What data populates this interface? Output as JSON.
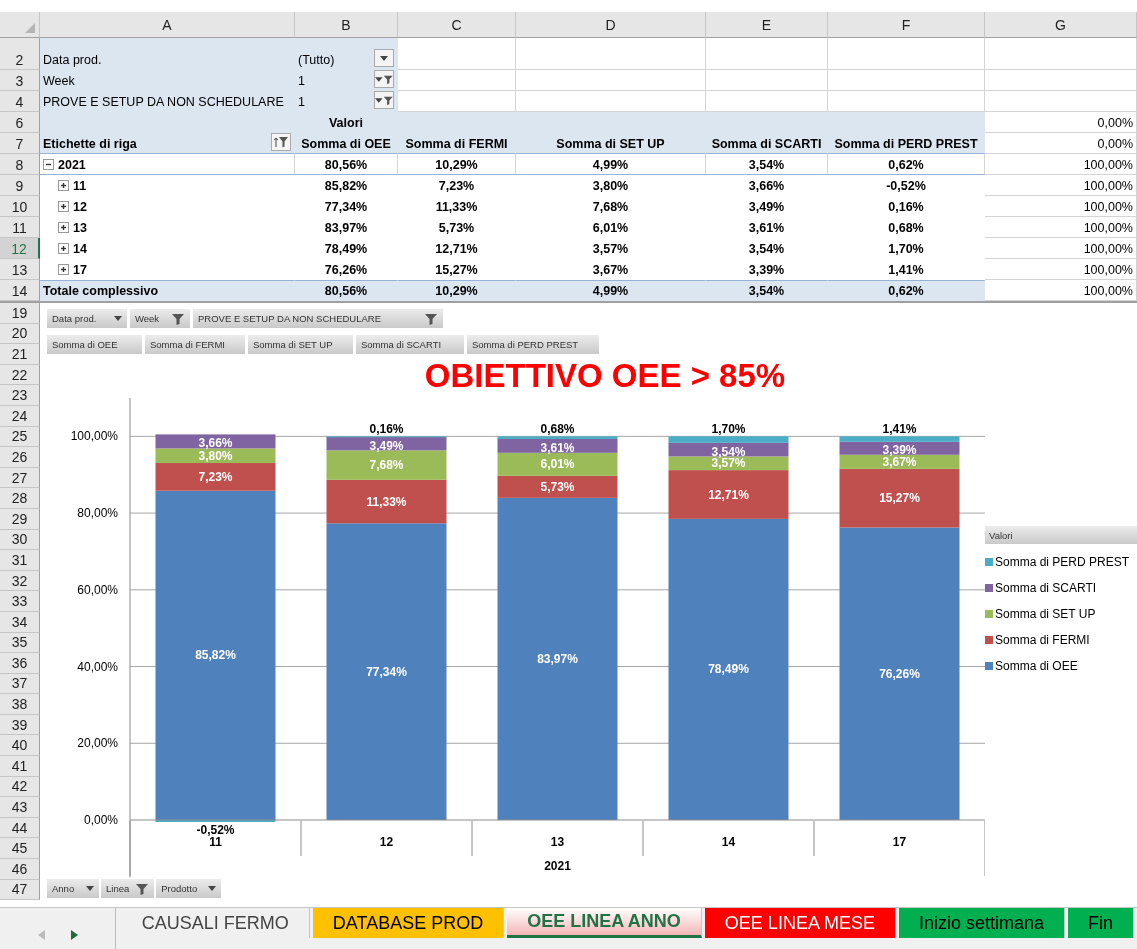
{
  "columns": [
    "A",
    "B",
    "C",
    "D",
    "E",
    "F",
    "G"
  ],
  "top_row_numbers": [
    {
      "label": "2",
      "selected": false
    },
    {
      "label": "3",
      "selected": false
    },
    {
      "label": "4",
      "selected": false
    },
    {
      "label": "6",
      "selected": false
    },
    {
      "label": "7",
      "selected": false
    },
    {
      "label": "8",
      "selected": false
    },
    {
      "label": "9",
      "selected": false
    },
    {
      "label": "10",
      "selected": false
    },
    {
      "label": "11",
      "selected": false
    },
    {
      "label": "12",
      "selected": true
    },
    {
      "label": "13",
      "selected": false
    },
    {
      "label": "14",
      "selected": false
    }
  ],
  "report_filters": [
    {
      "label": "Data prod.",
      "value": "(Tutto)",
      "filtered": false
    },
    {
      "label": "Week",
      "value": "1",
      "filtered": true
    },
    {
      "label": "PROVE E SETUP DA NON SCHEDULARE",
      "value": "1",
      "filtered": true
    }
  ],
  "pivot": {
    "values_header": "Valori",
    "row_label_header": "Etichette di riga",
    "columns": [
      "Somma di OEE",
      "Somma di FERMI",
      "Somma di SET UP",
      "Somma di SCARTI",
      "Somma di PERD PREST"
    ],
    "rows": [
      {
        "label": "2021",
        "expanded": true,
        "values": [
          "80,56%",
          "10,29%",
          "4,99%",
          "3,54%",
          "0,62%"
        ],
        "children": [
          {
            "label": "11",
            "expanded": false,
            "values": [
              "85,82%",
              "7,23%",
              "3,80%",
              "3,66%",
              "-0,52%"
            ]
          },
          {
            "label": "12",
            "expanded": false,
            "values": [
              "77,34%",
              "11,33%",
              "7,68%",
              "3,49%",
              "0,16%"
            ]
          },
          {
            "label": "13",
            "expanded": false,
            "values": [
              "83,97%",
              "5,73%",
              "6,01%",
              "3,61%",
              "0,68%"
            ]
          },
          {
            "label": "14",
            "expanded": false,
            "values": [
              "78,49%",
              "12,71%",
              "3,57%",
              "3,54%",
              "1,70%"
            ]
          },
          {
            "label": "17",
            "expanded": false,
            "values": [
              "76,26%",
              "15,27%",
              "3,67%",
              "3,39%",
              "1,41%"
            ]
          }
        ]
      }
    ],
    "total": {
      "label": "Totale complessivo",
      "values": [
        "80,56%",
        "10,29%",
        "4,99%",
        "3,54%",
        "0,62%"
      ]
    }
  },
  "column_g": [
    "0,00%",
    "0,00%",
    "100,00%",
    "100,00%",
    "100,00%",
    "100,00%",
    "100,00%",
    "100,00%",
    "100,00%"
  ],
  "chart_row_numbers": [
    "19",
    "20",
    "21",
    "22",
    "23",
    "24",
    "25",
    "26",
    "27",
    "28",
    "29",
    "30",
    "31",
    "32",
    "33",
    "34",
    "35",
    "36",
    "37",
    "38",
    "39",
    "40",
    "41",
    "42",
    "43",
    "44",
    "45",
    "46",
    "47"
  ],
  "chart": {
    "filter_buttons": [
      {
        "label": "Data prod.",
        "filtered": false
      },
      {
        "label": "Week",
        "filtered": true
      },
      {
        "label": "PROVE E SETUP  DA NON SCHEDULARE",
        "filtered": true
      }
    ],
    "value_buttons": [
      "Somma di OEE",
      "Somma di FERMI",
      "Somma di SET UP",
      "Somma di SCARTI",
      "Somma di PERD PREST"
    ],
    "title": "OBIETTIVO OEE > 85%",
    "legend_title": "Valori",
    "axis_buttons": [
      {
        "label": "Anno",
        "filtered": false
      },
      {
        "label": "Linea",
        "filtered": true
      },
      {
        "label": "Prodotto",
        "filtered": false
      }
    ],
    "chart_data": {
      "type": "bar",
      "stacked": true,
      "orientation": "vertical",
      "grid": true,
      "xlabel": "2021",
      "categories": [
        "11",
        "12",
        "13",
        "14",
        "17"
      ],
      "ylim": [
        -15,
        110
      ],
      "yticks": [
        {
          "value": 0,
          "label": "0,00%"
        },
        {
          "value": 20,
          "label": "20,00%"
        },
        {
          "value": 40,
          "label": "40,00%"
        },
        {
          "value": 60,
          "label": "60,00%"
        },
        {
          "value": 80,
          "label": "80,00%"
        },
        {
          "value": 100,
          "label": "100,00%"
        }
      ],
      "series": [
        {
          "name": "Somma di OEE",
          "color": "#4f81bd",
          "values": [
            85.82,
            77.34,
            83.97,
            78.49,
            76.26
          ],
          "value_labels": [
            "85,82%",
            "77,34%",
            "83,97%",
            "78,49%",
            "76,26%"
          ]
        },
        {
          "name": "Somma di FERMI",
          "color": "#c0504d",
          "values": [
            7.23,
            11.33,
            5.73,
            12.71,
            15.27
          ],
          "value_labels": [
            "7,23%",
            "11,33%",
            "5,73%",
            "12,71%",
            "15,27%"
          ]
        },
        {
          "name": "Somma di SET UP",
          "color": "#9bbb59",
          "values": [
            3.8,
            7.68,
            6.01,
            3.57,
            3.67
          ],
          "value_labels": [
            "3,80%",
            "7,68%",
            "6,01%",
            "3,57%",
            "3,67%"
          ]
        },
        {
          "name": "Somma di SCARTI",
          "color": "#8064a2",
          "values": [
            3.66,
            3.49,
            3.61,
            3.54,
            3.39
          ],
          "value_labels": [
            "3,66%",
            "3,49%",
            "3,61%",
            "3,54%",
            "3,39%"
          ]
        },
        {
          "name": "Somma di PERD PREST",
          "color": "#4bacc6",
          "values": [
            -0.52,
            0.16,
            0.68,
            1.7,
            1.41
          ],
          "value_labels": [
            "-0,52%",
            "0,16%",
            "0,68%",
            "1,70%",
            "1,41%"
          ]
        }
      ]
    }
  },
  "sheet_tabs": [
    {
      "label": "CAUSALI FERMO",
      "selected": false
    },
    {
      "label": "DATABASE PROD",
      "selected": false,
      "color": "#ffc000"
    },
    {
      "label": "OEE LINEA ANNO",
      "selected": true,
      "color": "#f4b6b6"
    },
    {
      "label": "OEE LINEA MESE",
      "selected": false,
      "color": "#ff0000"
    },
    {
      "label": "Inizio settimana",
      "selected": false,
      "color": "#00b050"
    },
    {
      "label": "Fin",
      "selected": false,
      "color": "#00b050"
    }
  ]
}
